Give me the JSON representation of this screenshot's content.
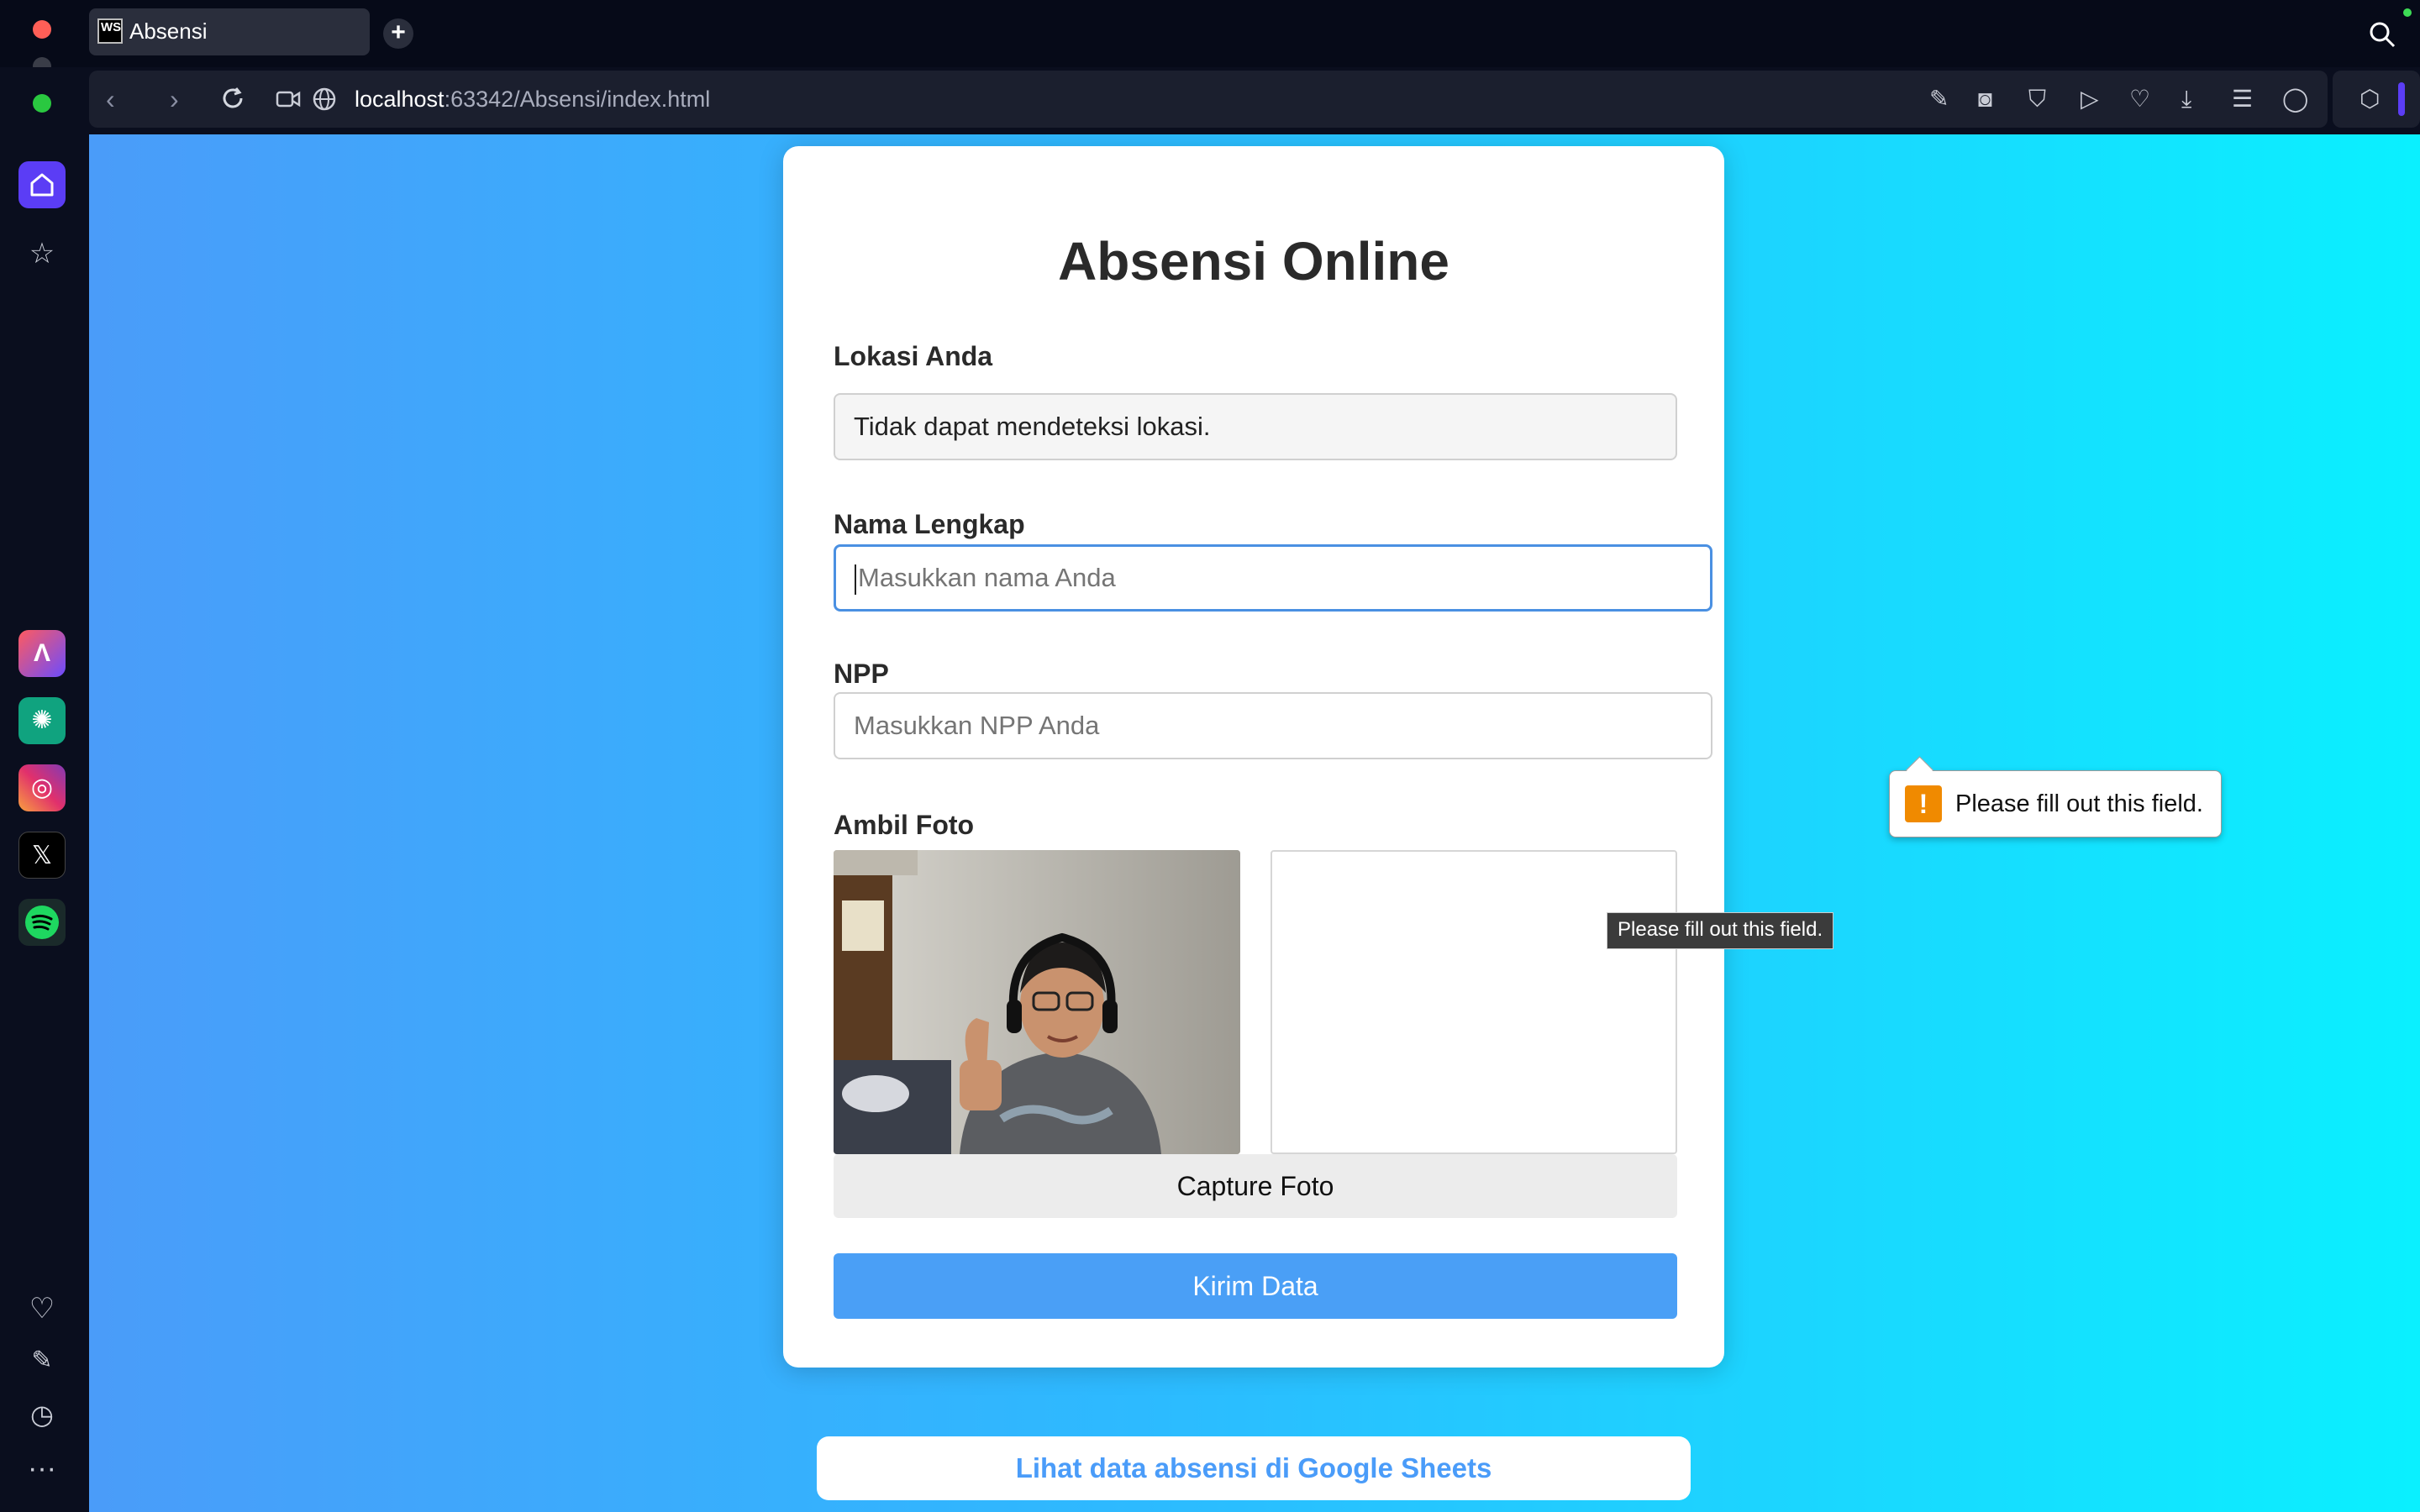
{
  "browser": {
    "tab_title": "Absensi",
    "tab_favicon_text": "WS",
    "url_host": "localhost",
    "url_rest": ":63342/Absensi/index.html",
    "icons": [
      "back-icon",
      "forward-icon",
      "reload-icon",
      "camera-icon",
      "globe-icon"
    ]
  },
  "page": {
    "title": "Absensi Online",
    "lokasi_label": "Lokasi Anda",
    "lokasi_value": "Tidak dapat mendeteksi lokasi.",
    "nama_label": "Nama Lengkap",
    "nama_placeholder": "Masukkan nama Anda",
    "npp_label": "NPP",
    "npp_placeholder": "Masukkan NPP Anda",
    "foto_label": "Ambil Foto",
    "capture_button": "Capture Foto",
    "submit_button": "Kirim Data",
    "sheets_link": "Lihat data absensi di Google Sheets"
  },
  "validation": {
    "bubble_text": "Please fill out this field.",
    "bubble_icon": "!",
    "tooltip_text": "Please fill out this field."
  },
  "colors": {
    "accent": "#4a9ff6",
    "gradient_start": "#4a9cf9",
    "gradient_end": "#0af0ff",
    "sidebar_active": "#5b3df5"
  }
}
